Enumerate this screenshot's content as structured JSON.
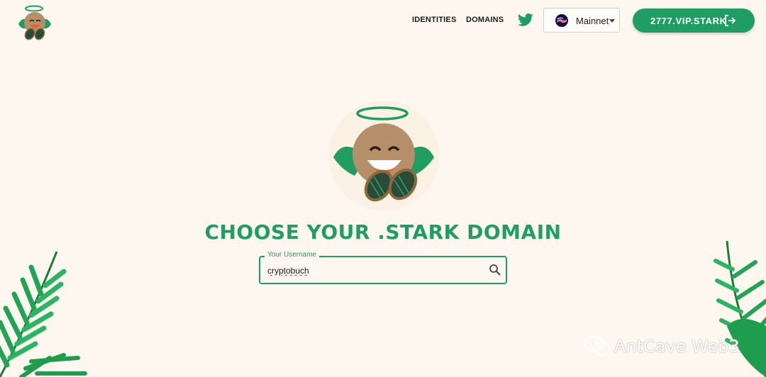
{
  "nav": {
    "identities_label": "IDENTITIES",
    "domains_label": "DOMAINS",
    "network_label": "Mainnet",
    "account_label": "2777.VIP.STARK"
  },
  "main": {
    "title": "CHOOSE YOUR .STARK DOMAIN",
    "search": {
      "label": "Your Username",
      "value": "cryptobuch"
    }
  },
  "watermark": {
    "text": "AntCave Web3"
  },
  "colors": {
    "brand_green": "#1f9d63",
    "background": "#fdf7ef",
    "skin": "#b58e6a"
  },
  "icons": {
    "twitter": "twitter-icon",
    "network": "starknet-logo-icon",
    "account": "logout-icon",
    "search": "search-icon"
  }
}
